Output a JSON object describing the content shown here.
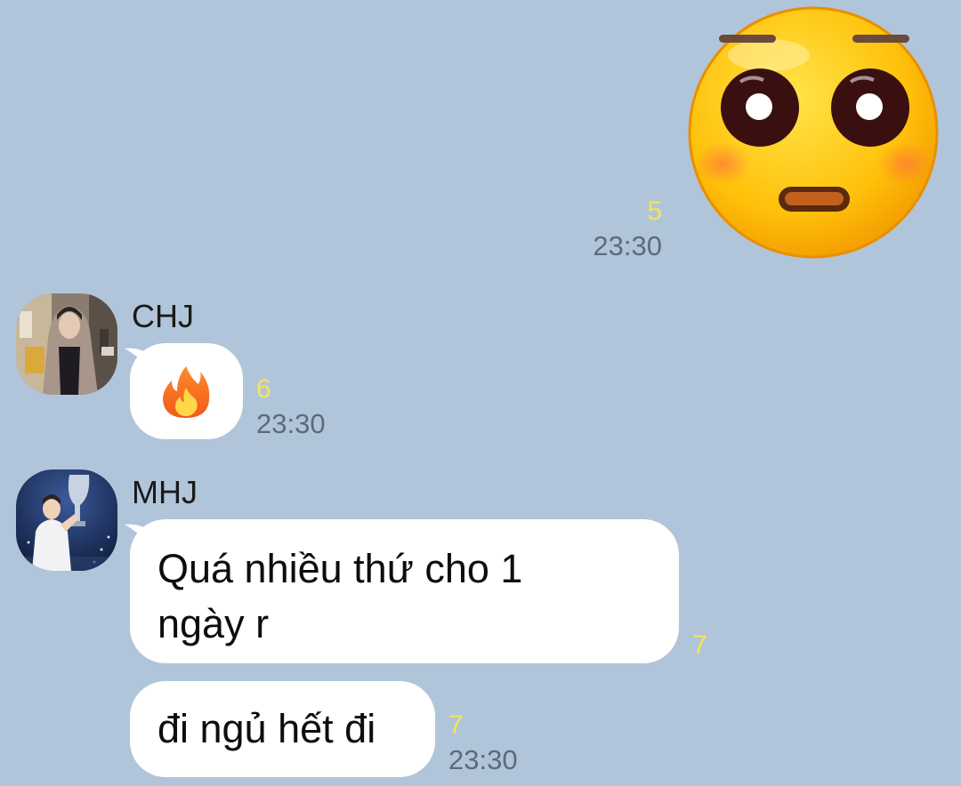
{
  "messages": {
    "sent_sticker": {
      "sticker": "blushing-face-sticker",
      "unread": "5",
      "time": "23:30"
    },
    "chj": {
      "sender": "CHJ",
      "avatar": "hooded-person-avatar",
      "emoji": "🔥",
      "unread": "6",
      "time": "23:30"
    },
    "mhj": {
      "sender": "MHJ",
      "avatar": "trophy-holder-avatar",
      "bubble1_line1": "Quá nhiều thứ cho 1",
      "bubble1_line2": "ngày r",
      "bubble1_unread": "7",
      "bubble2_text": "đi ngủ hết đi",
      "bubble2_unread": "7",
      "bubble2_time": "23:30"
    }
  },
  "colors": {
    "background": "#b1c5da",
    "bubble": "#ffffff",
    "unread_count": "#f4e45a",
    "timestamp": "#5e6a76"
  }
}
